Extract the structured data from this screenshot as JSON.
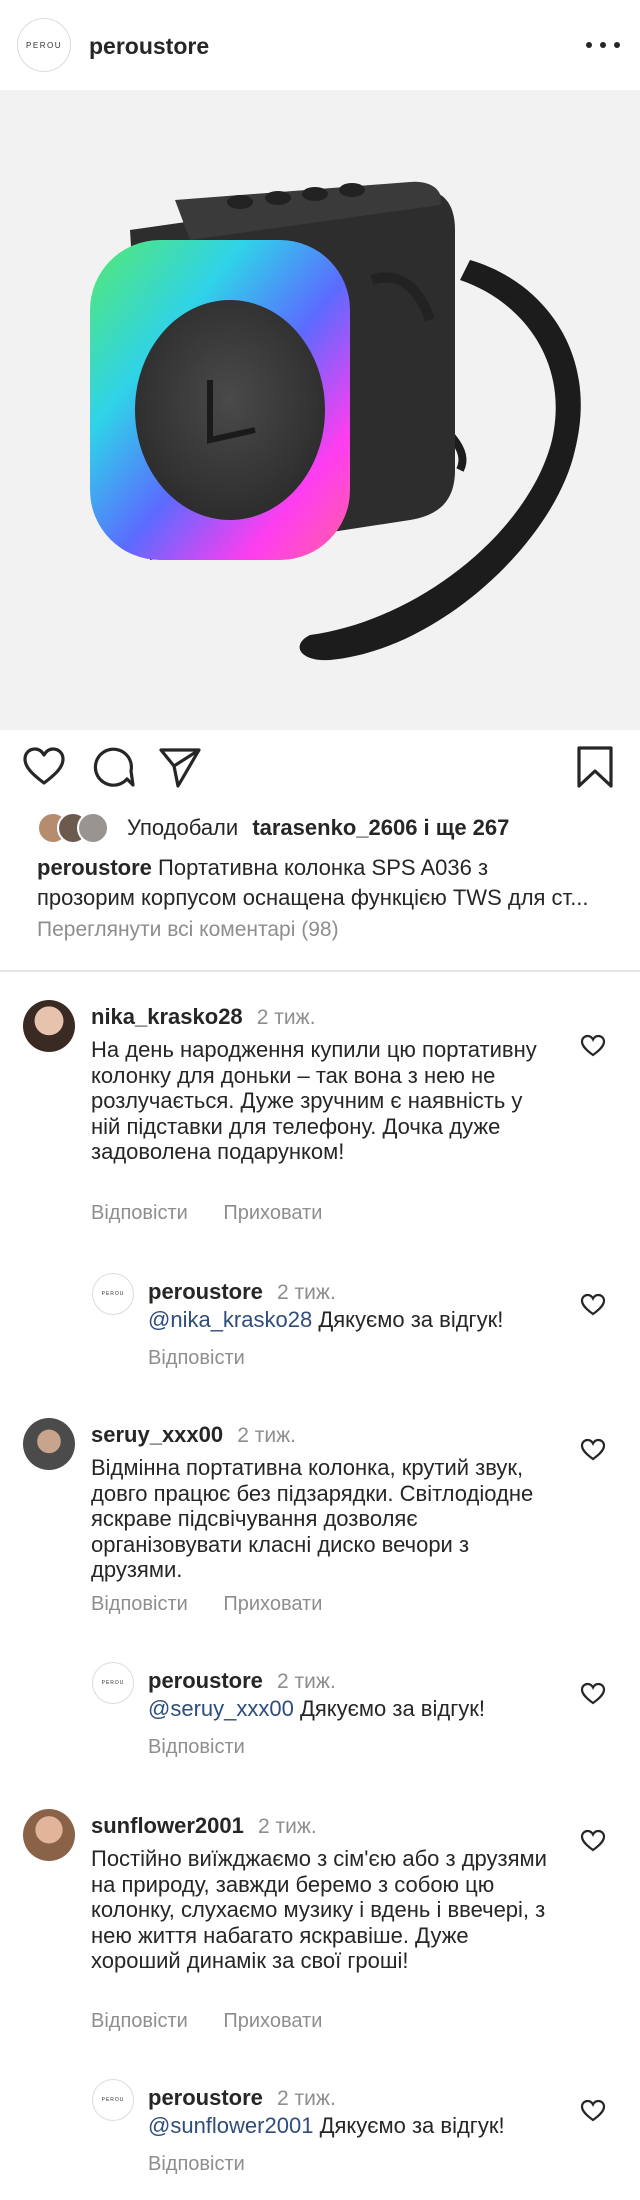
{
  "header": {
    "logo_text": "PEROU",
    "username": "peroustore"
  },
  "likes": {
    "prefix": "Уподобали",
    "names": "tarasenko_2606 і ще 267"
  },
  "caption": {
    "username": "peroustore",
    "text_line1": "Портативна колонка SPS A036 з",
    "text_line2": "прозорим корпусом оснащена функцією TWS для ст..."
  },
  "view_all_comments": "Переглянути всі коментарі (98)",
  "labels": {
    "reply": "Відповісти",
    "hide": "Приховати"
  },
  "comments": [
    {
      "username": "nika_krasko28",
      "time": "2 тиж.",
      "text": "На день народження купили цю портативну колонку для доньки – так вона з нею не розлучається. Дуже зручним є наявність у ній підставки для телефону. Дочка дуже задоволена подарунком!",
      "reply": {
        "username": "peroustore",
        "time": "2 тиж.",
        "mention": "@nika_krasko28",
        "text": "Дякуємо за відгук!"
      }
    },
    {
      "username": "seruy_xxx00",
      "time": "2 тиж.",
      "text": "Відмінна портативна колонка, крутий звук, довго працює без підзарядки. Світлодіодне яскраве підсвічування дозволяє організовувати класні диско вечори з друзями.",
      "reply": {
        "username": "peroustore",
        "time": "2 тиж.",
        "mention": "@seruy_xxx00",
        "text": "Дякуємо за відгук!"
      }
    },
    {
      "username": "sunflower2001",
      "time": "2 тиж.",
      "text": "Постійно виїжджаємо з сім'єю або з друзями на природу, завжди беремо з собою цю колонку, слухаємо музику і вдень і ввечері, з нею життя набагато яскравіше. Дуже хороший динамік за свої гроші!",
      "reply": {
        "username": "peroustore",
        "time": "2 тиж.",
        "mention": "@sunflower2001",
        "text": "Дякуємо за відгук!"
      }
    }
  ],
  "icons": {
    "like": "heart-icon",
    "comment": "comment-icon",
    "share": "paper-plane-icon",
    "save": "bookmark-icon",
    "more": "more-dots-icon"
  }
}
